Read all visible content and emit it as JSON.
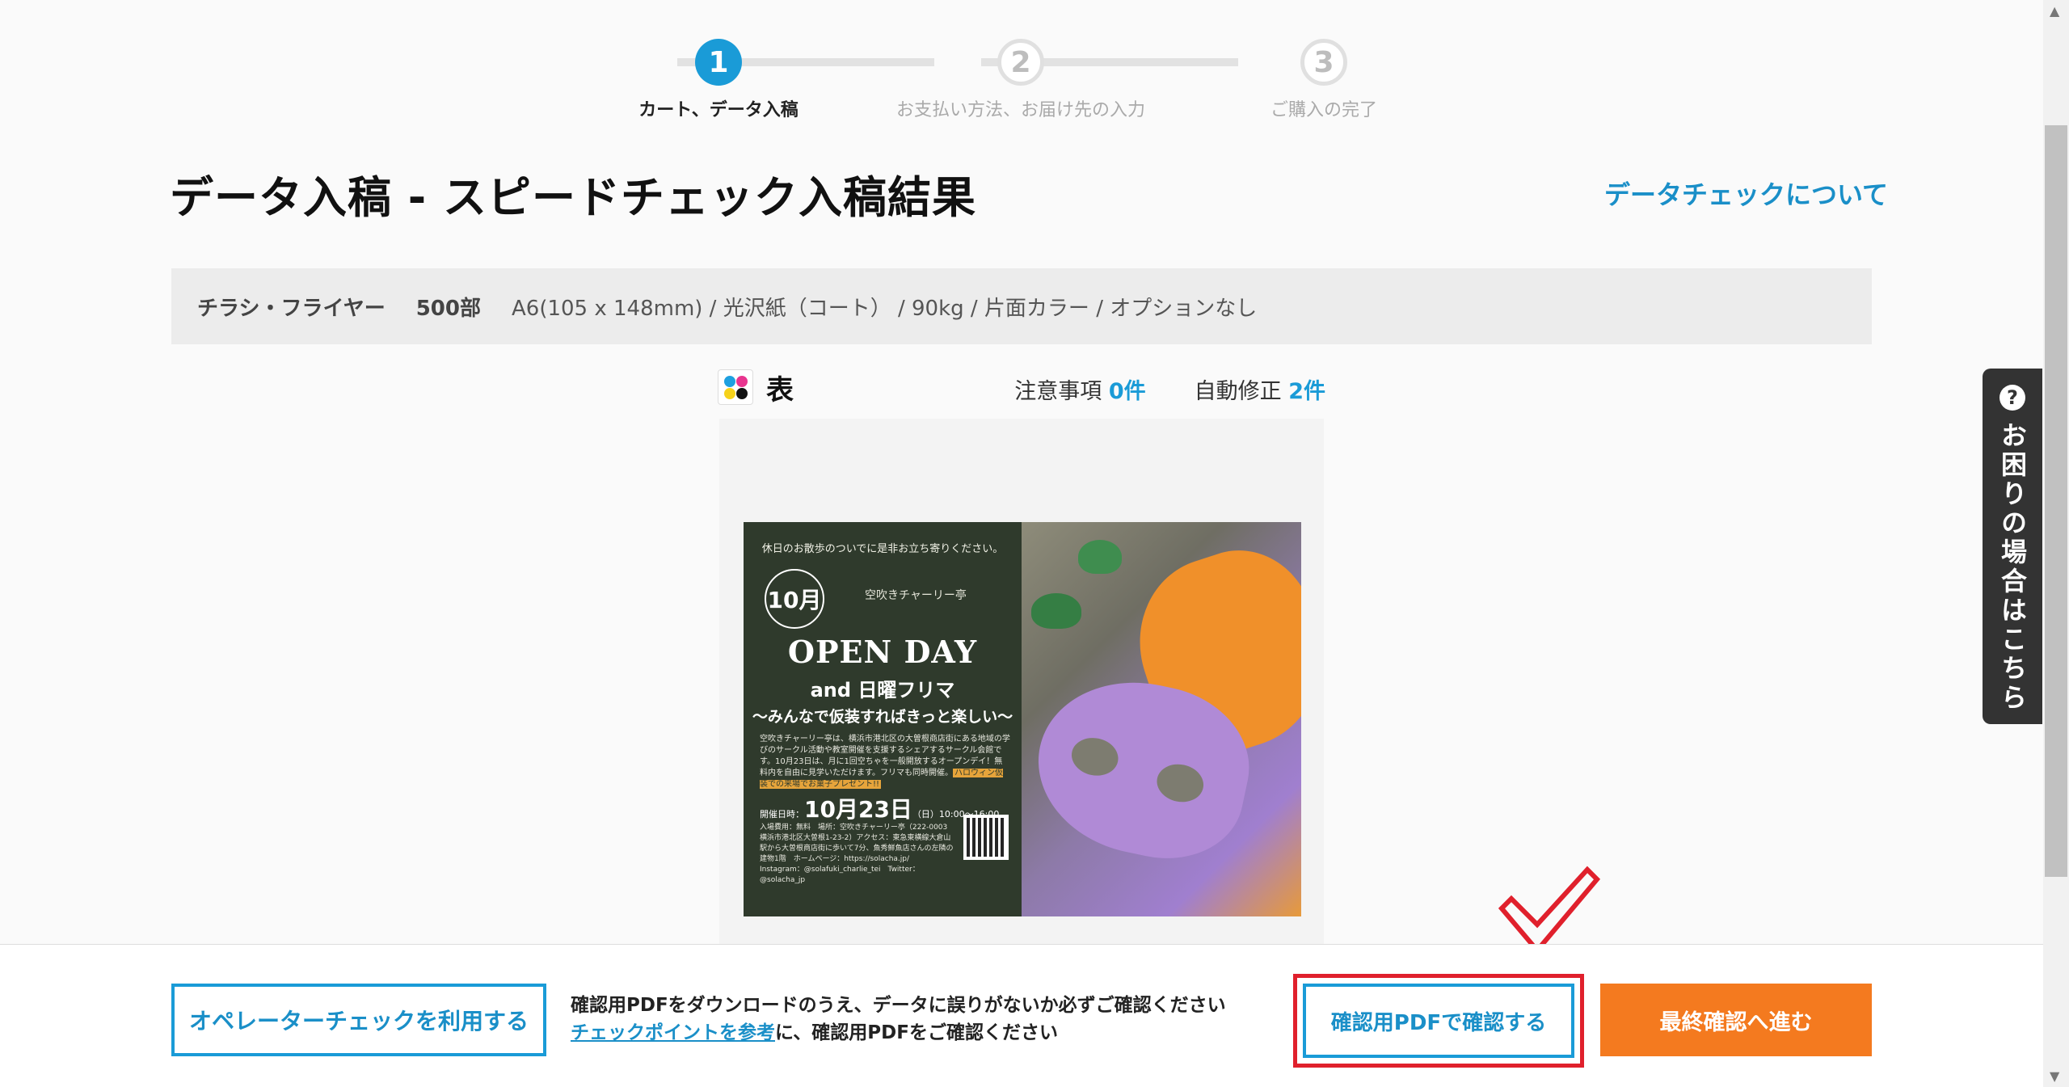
{
  "stepper": {
    "steps": [
      {
        "number": "1",
        "label": "カート、データ入稿"
      },
      {
        "number": "2",
        "label": "お支払い方法、お届け先の入力"
      },
      {
        "number": "3",
        "label": "ご購入の完了"
      }
    ]
  },
  "header": {
    "title": "データ入稿 - スピードチェック入稿結果",
    "about_link": "データチェックについて"
  },
  "order": {
    "product": "チラシ・フライヤー",
    "quantity": "500部",
    "spec": "A6(105 x 148mm) / 光沢紙（コート） / 90kg / 片面カラー / オプションなし"
  },
  "side": {
    "label": "表",
    "warnings_label": "注意事項",
    "warnings_count": "0件",
    "autofix_label": "自動修正",
    "autofix_count": "2件"
  },
  "flyer": {
    "top_line": "休日のお散歩のついでに是非お立ち寄りください。",
    "month": "10月",
    "logo": "空吹きチャーリー亭",
    "headline": "OPEN DAY",
    "subheadline": "and 日曜フリマ",
    "tagline": "〜みんなで仮装すればきっと楽しい〜",
    "body": "空吹きチャーリー亭は、横浜市港北区の大曽根商店街にある地域の学びのサークル活動や教室開催を支援するシェアするサークル会館です。10月23日は、月に1回空ちゃを一般開放するオープンデイ！無料内を自由に見学いただけます。フリマも同時開催。",
    "highlight": "ハロウィン仮装での来場でお菓子プレゼント!!",
    "date_prefix": "開催日時：",
    "date_big": "10月23日",
    "date_suffix": "（日）10:00〜16:00",
    "info": "入場費用：無料　場所：空吹きチャーリー亭（222-0003 横浜市港北区大曽根1-23-2）アクセス：東急東横線大倉山駅から大曽根商店街に歩いて7分、魚秀鮮魚店さんの左隣の建物1階　ホームページ：https://solacha.jp/　Instagram：@solafuki_charlie_tei　Twitter：@solacha_jp"
  },
  "help": {
    "icon": "?",
    "label": "お困りの場合はこちら"
  },
  "footer": {
    "operator_button": "オペレーターチェックを利用する",
    "notice_line1": "確認用PDFをダウンロードのうえ、データに誤りがないか必ずご確認ください",
    "notice_link": "チェックポイントを参考",
    "notice_line2_rest": "に、確認用PDFをご確認ください",
    "pdf_button": "確認用PDFで確認する",
    "final_button": "最終確認へ進む"
  },
  "colors": {
    "accent": "#1a9bd7",
    "cta": "#f47a1f",
    "highlight_box": "#e0202c"
  }
}
